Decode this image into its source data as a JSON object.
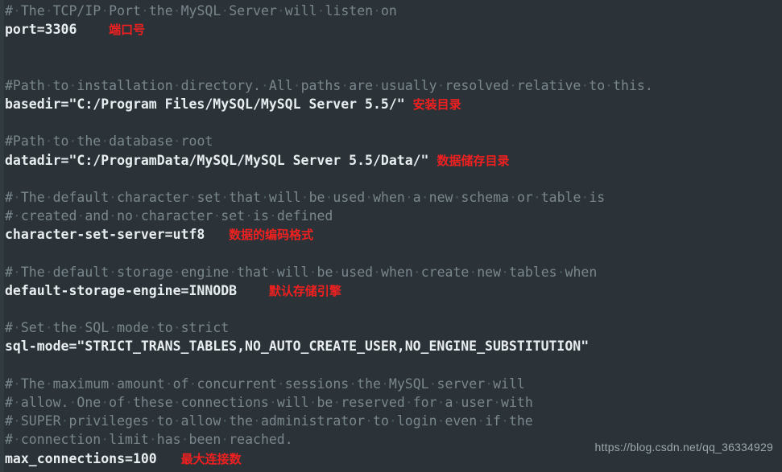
{
  "app": {
    "kind": "text-editor-code-view",
    "file_type": "mysql-my-ini-config",
    "background_color": "#2b3338",
    "gutter_color": "#323c40",
    "comment_color": "#79878d",
    "code_color": "#e8edf0",
    "annotation_color": "#f02020",
    "whitespace_dot_color": "#4b585e"
  },
  "watermark": {
    "text": "https://blog.csdn.net/qq_36334929"
  },
  "annotations": {
    "port": "端口号",
    "basedir": "安装目录",
    "datadir": "数据储存目录",
    "charset": "数据的编码格式",
    "engine": "默认存储引擎",
    "max_connections": "最大连接数"
  },
  "lines": [
    {
      "n": 1,
      "type": "comment",
      "text": "# The TCP/IP Port the MySQL Server will listen on",
      "annotation": ""
    },
    {
      "n": 2,
      "type": "code",
      "text": "port=3306",
      "annotation": "端口号"
    },
    {
      "n": 3,
      "type": "blank",
      "text": "",
      "annotation": ""
    },
    {
      "n": 4,
      "type": "blank",
      "text": "",
      "annotation": ""
    },
    {
      "n": 5,
      "type": "comment",
      "text": "#Path to installation directory. All paths are usually resolved relative to this.",
      "annotation": ""
    },
    {
      "n": 6,
      "type": "code",
      "text": "basedir=\"C:/Program Files/MySQL/MySQL Server 5.5/\"",
      "annotation": "安装目录"
    },
    {
      "n": 7,
      "type": "blank",
      "text": "",
      "annotation": ""
    },
    {
      "n": 8,
      "type": "comment",
      "text": "#Path to the database root",
      "annotation": ""
    },
    {
      "n": 9,
      "type": "code",
      "text": "datadir=\"C:/ProgramData/MySQL/MySQL Server 5.5/Data/\"",
      "annotation": "数据储存目录"
    },
    {
      "n": 10,
      "type": "blank",
      "text": "",
      "annotation": ""
    },
    {
      "n": 11,
      "type": "comment",
      "text": "# The default character set that will be used when a new schema or table is",
      "annotation": ""
    },
    {
      "n": 12,
      "type": "comment",
      "text": "# created and no character set is defined",
      "annotation": ""
    },
    {
      "n": 13,
      "type": "code",
      "text": "character-set-server=utf8",
      "annotation": "数据的编码格式"
    },
    {
      "n": 14,
      "type": "blank",
      "text": "",
      "annotation": ""
    },
    {
      "n": 15,
      "type": "comment",
      "text": "# The default storage engine that will be used when create new tables when",
      "annotation": ""
    },
    {
      "n": 16,
      "type": "code",
      "text": "default-storage-engine=INNODB",
      "annotation": "默认存储引擎"
    },
    {
      "n": 17,
      "type": "blank",
      "text": "",
      "annotation": ""
    },
    {
      "n": 18,
      "type": "comment",
      "text": "# Set the SQL mode to strict",
      "annotation": ""
    },
    {
      "n": 19,
      "type": "code",
      "text": "sql-mode=\"STRICT_TRANS_TABLES,NO_AUTO_CREATE_USER,NO_ENGINE_SUBSTITUTION\"",
      "annotation": ""
    },
    {
      "n": 20,
      "type": "blank",
      "text": "",
      "annotation": ""
    },
    {
      "n": 21,
      "type": "comment",
      "text": "# The maximum amount of concurrent sessions the MySQL server will",
      "annotation": ""
    },
    {
      "n": 22,
      "type": "comment",
      "text": "# allow. One of these connections will be reserved for a user with",
      "annotation": ""
    },
    {
      "n": 23,
      "type": "comment",
      "text": "# SUPER privileges to allow the administrator to login even if the",
      "annotation": ""
    },
    {
      "n": 24,
      "type": "comment",
      "text": "# connection limit has been reached.",
      "annotation": ""
    },
    {
      "n": 25,
      "type": "code",
      "text": "max_connections=100",
      "annotation": "最大连接数"
    }
  ]
}
